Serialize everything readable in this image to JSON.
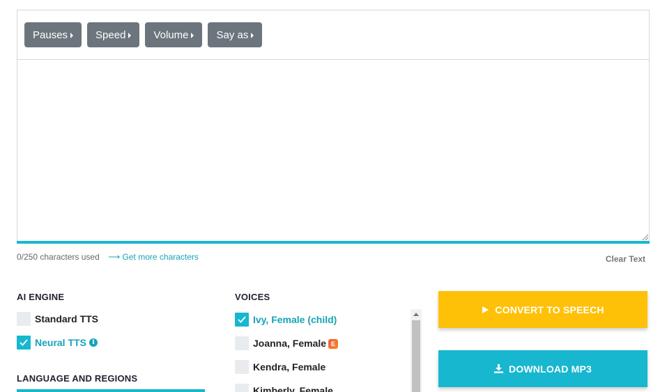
{
  "toolbar": {
    "buttons": [
      "Pauses",
      "Speed",
      "Volume",
      "Say as"
    ]
  },
  "editor": {
    "text": "",
    "char_count": "0/250 characters used",
    "more_chars_label": "Get more characters",
    "clear_label": "Clear Text"
  },
  "ai_engine": {
    "title": "AI ENGINE",
    "options": [
      {
        "label": "Standard TTS",
        "checked": false
      },
      {
        "label": "Neural TTS",
        "checked": true
      }
    ]
  },
  "language": {
    "title": "LANGUAGE AND REGIONS"
  },
  "voices": {
    "title": "VOICES",
    "items": [
      {
        "label": "Ivy, Female (child)",
        "checked": true
      },
      {
        "label": "Joanna, Female",
        "checked": false,
        "badge": "E"
      },
      {
        "label": "Kendra, Female",
        "checked": false
      },
      {
        "label": "Kimberly, Female",
        "checked": false
      }
    ]
  },
  "actions": {
    "convert_label": "CONVERT TO SPEECH",
    "download_label": "DOWNLOAD MP3"
  },
  "colors": {
    "accent": "#17b7cf",
    "convert": "#ffc107",
    "toolbar_button": "#6c757d"
  }
}
